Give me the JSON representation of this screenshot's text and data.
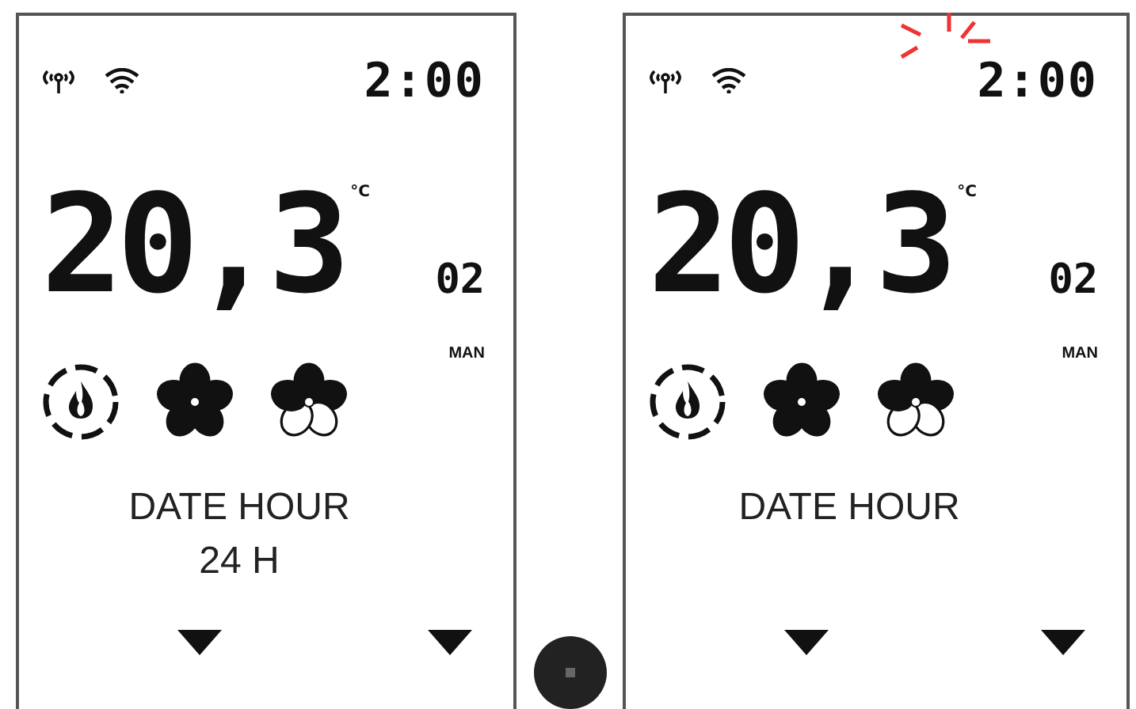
{
  "screens": [
    {
      "time": "2:00",
      "time_blinking": false,
      "temperature": "20,3",
      "unit": "°C",
      "zone": "02",
      "mode": "MAN",
      "caption": [
        "DATE HOUR",
        "24 H"
      ]
    },
    {
      "time": "2:00",
      "time_blinking": true,
      "temperature": "20,3",
      "unit": "°C",
      "zone": "02",
      "mode": "MAN",
      "caption": [
        "DATE HOUR"
      ]
    }
  ]
}
